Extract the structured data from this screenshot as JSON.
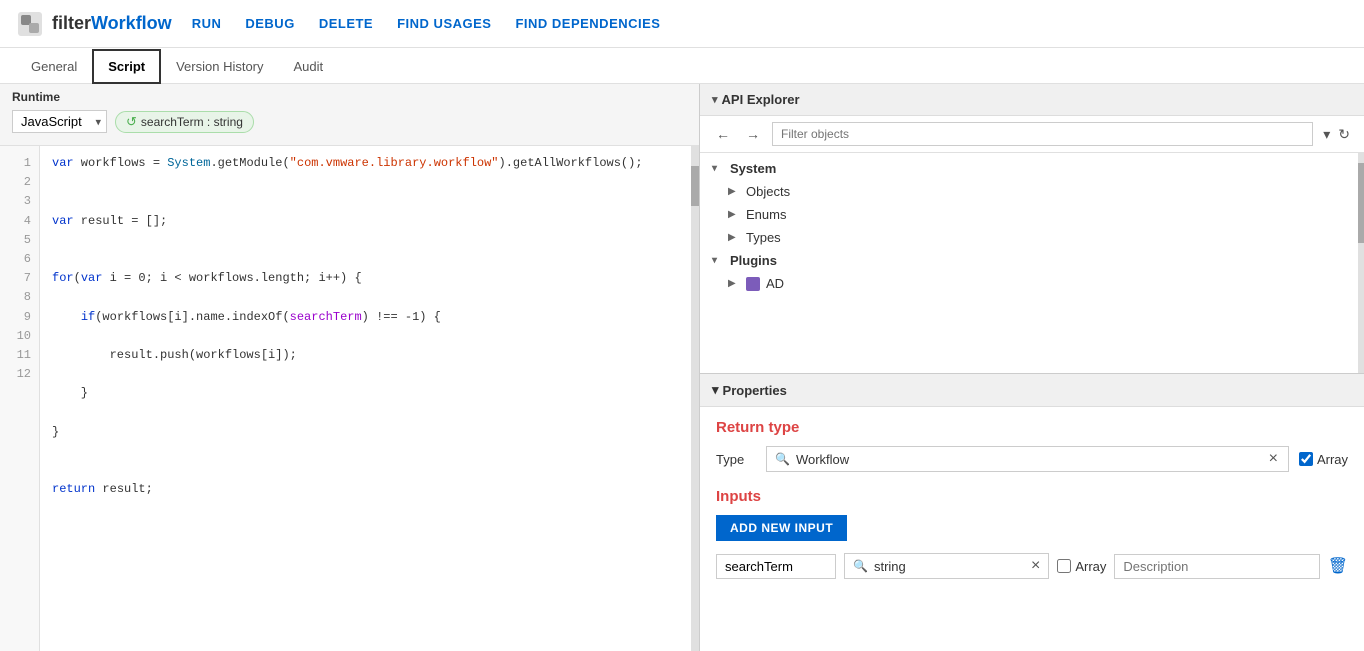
{
  "app": {
    "title_filter": "filter",
    "title_workflow": "Workflow",
    "logo_alt": "App logo"
  },
  "top_nav": {
    "items": [
      {
        "label": "RUN",
        "id": "run"
      },
      {
        "label": "DEBUG",
        "id": "debug"
      },
      {
        "label": "DELETE",
        "id": "delete"
      },
      {
        "label": "FIND USAGES",
        "id": "find-usages"
      },
      {
        "label": "FIND DEPENDENCIES",
        "id": "find-dependencies"
      }
    ]
  },
  "tabs": [
    {
      "label": "General",
      "id": "general",
      "active": false
    },
    {
      "label": "Script",
      "id": "script",
      "active": true
    },
    {
      "label": "Version History",
      "id": "version-history",
      "active": false
    },
    {
      "label": "Audit",
      "id": "audit",
      "active": false
    }
  ],
  "code_panel": {
    "runtime_label": "Runtime",
    "runtime_value": "JavaScript",
    "param_tag": "searchTerm : string",
    "lines": [
      {
        "num": "1",
        "content": "var workflows = System.getModule(\"com.vmware.library.workflow\").getAllWorkflows();"
      },
      {
        "num": "2",
        "content": ""
      },
      {
        "num": "3",
        "content": "var result = [];"
      },
      {
        "num": "4",
        "content": ""
      },
      {
        "num": "5",
        "content": "for(var i = 0; i < workflows.length; i++) {"
      },
      {
        "num": "6",
        "content": "    if(workflows[i].name.indexOf(searchTerm) !== -1) {"
      },
      {
        "num": "7",
        "content": "        result.push(workflows[i]);"
      },
      {
        "num": "8",
        "content": "    }"
      },
      {
        "num": "9",
        "content": "}"
      },
      {
        "num": "10",
        "content": ""
      },
      {
        "num": "11",
        "content": "return result;"
      },
      {
        "num": "12",
        "content": ""
      }
    ]
  },
  "api_explorer": {
    "title": "API Explorer",
    "filter_placeholder": "Filter objects",
    "tree": {
      "system": {
        "label": "System",
        "children": [
          {
            "label": "Objects",
            "expanded": false
          },
          {
            "label": "Enums",
            "expanded": false
          },
          {
            "label": "Types",
            "expanded": false
          }
        ]
      },
      "plugins": {
        "label": "Plugins",
        "children": [
          {
            "label": "AD",
            "has_icon": true
          }
        ]
      }
    }
  },
  "properties": {
    "title": "Properties",
    "return_type": {
      "heading": "Return type",
      "type_label": "Type",
      "type_value": "Workflow",
      "array_checked": true,
      "array_label": "Array"
    },
    "inputs": {
      "heading": "Inputs",
      "add_btn_label": "ADD NEW INPUT",
      "rows": [
        {
          "name": "searchTerm",
          "type": "string",
          "array_checked": false,
          "array_label": "Array",
          "description_placeholder": "Description"
        }
      ]
    }
  }
}
